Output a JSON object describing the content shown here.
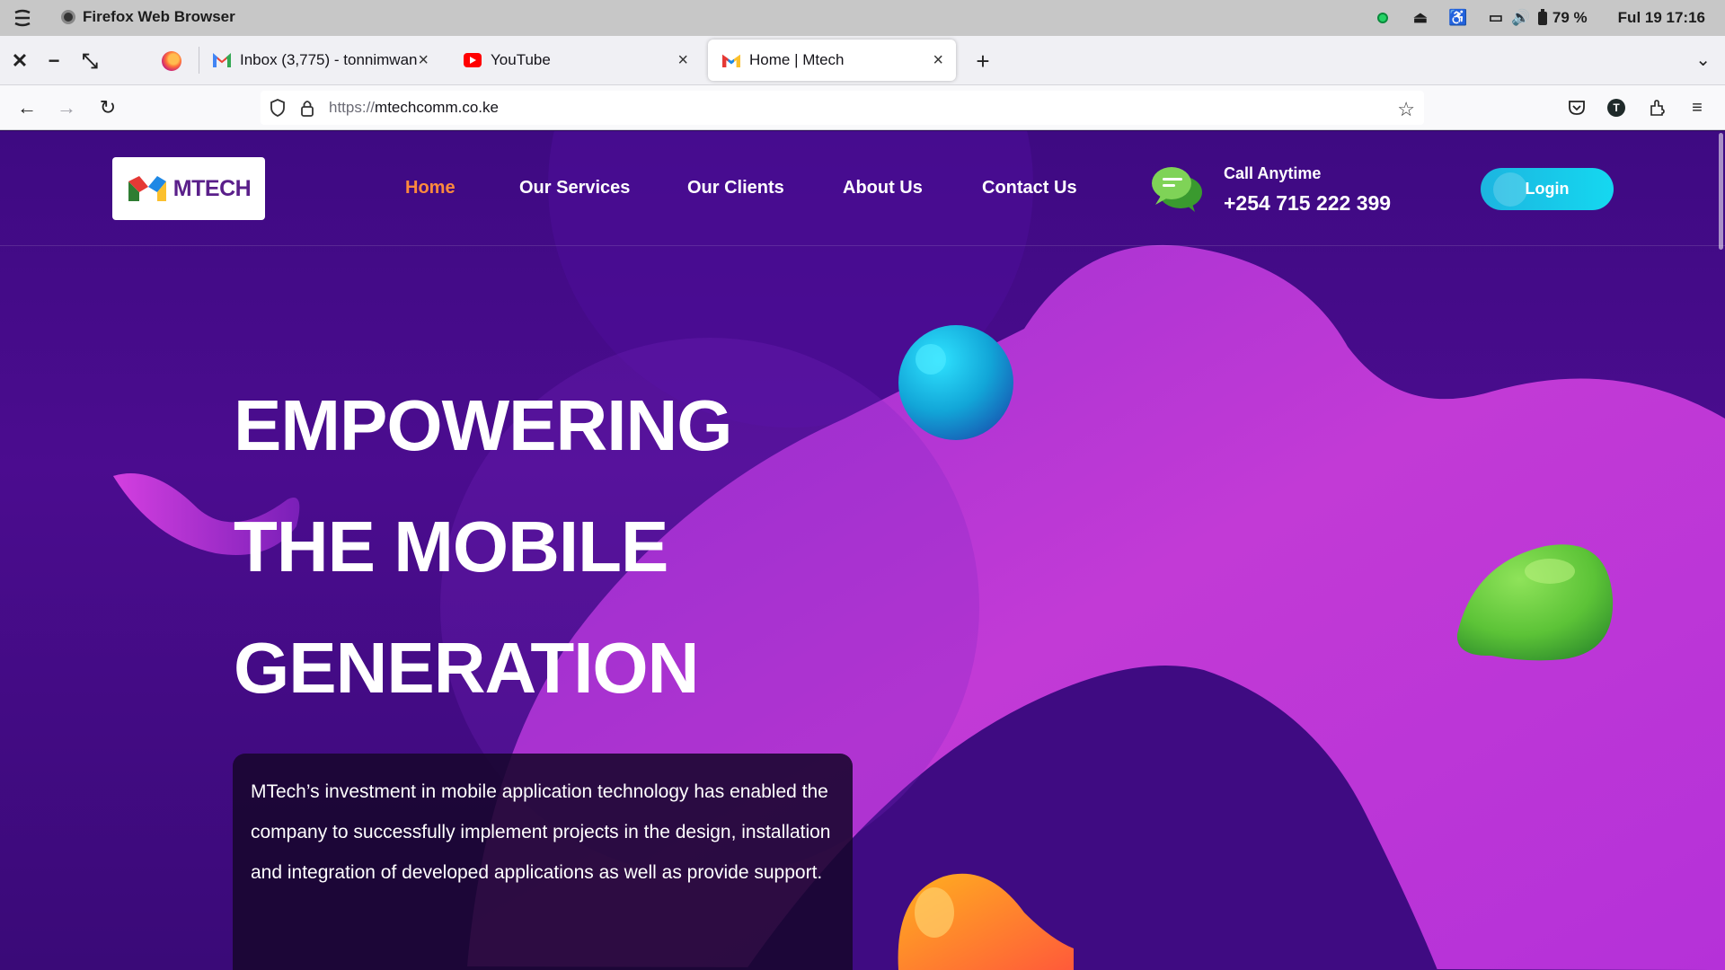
{
  "os": {
    "app_name": "Firefox Web Browser",
    "battery": "79 %",
    "datetime": "Ful 19  17:16"
  },
  "tabs": [
    {
      "title": "Inbox (3,775) - tonnimwan",
      "icon": "gmail-icon"
    },
    {
      "title": "YouTube",
      "icon": "youtube-icon"
    },
    {
      "title": "Home | Mtech",
      "icon": "mtech-icon",
      "active": true
    }
  ],
  "toolbar": {
    "url_protocol": "https://",
    "url_host": "mtechcomm.co.ke",
    "account_initial": "T"
  },
  "site": {
    "logo_text": "MTECH",
    "nav": [
      "Home",
      "Our Services",
      "Our Clients",
      "About Us",
      "Contact Us"
    ],
    "nav_active": "Home",
    "call_label": "Call Anytime",
    "call_number": "+254 715 222 399",
    "login_label": "Login",
    "hero_lines": [
      "EMPOWERING",
      "THE MOBILE",
      "GENERATION"
    ],
    "hero_description": "MTech’s investment in mobile application technology has enabled the company to successfully implement projects in the design, installation and integration of developed applications as well as provide support.",
    "colors": {
      "nav_active": "#ff8a3d",
      "login_button": "#15d8f0",
      "background": "#4b0c8f",
      "wave": "#c23ad6"
    }
  }
}
